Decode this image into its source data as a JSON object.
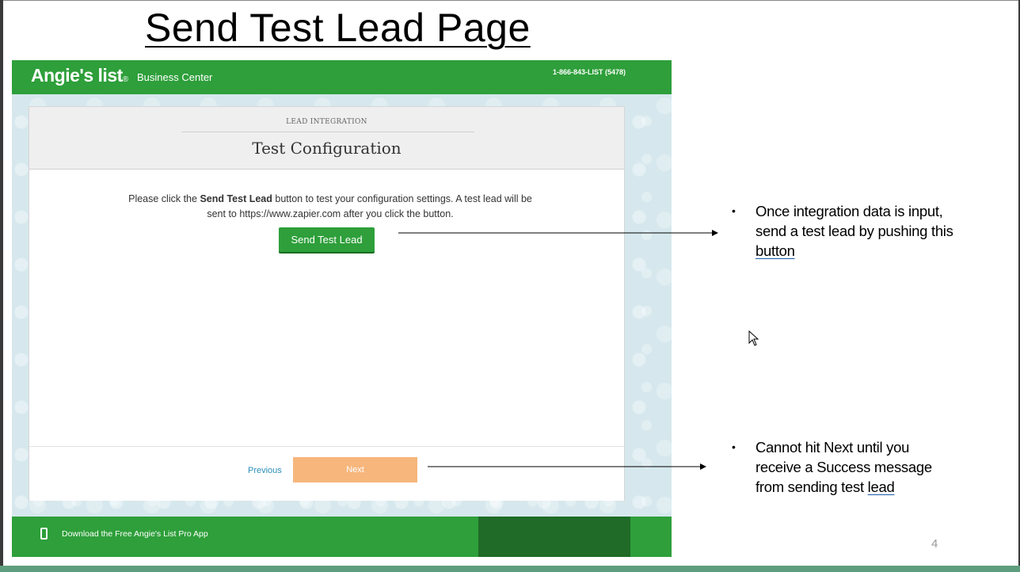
{
  "slide": {
    "title": "Send Test Lead Page",
    "page_number": "4"
  },
  "app": {
    "logo_text": "Angie's list",
    "logo_mark": "®",
    "logo_subtitle": "Business Center",
    "phone": "1-866-843-LIST (5478)",
    "section_label": "LEAD INTEGRATION",
    "card_title": "Test Configuration",
    "instructions_pre": "Please click the ",
    "instructions_bold": "Send Test Lead",
    "instructions_post": " button to test your configuration settings. A test lead will be sent to https://www.zapier.com after you click the button.",
    "send_button_label": "Send Test Lead",
    "previous_label": "Previous",
    "next_label": "Next",
    "footer_text": "Download the Free Angie's List Pro App",
    "colors": {
      "brand_green": "#2e9f3a",
      "next_disabled": "#f6b67c",
      "link_blue": "#2b8fb8"
    }
  },
  "annotations": [
    {
      "text": "Once integration data is input, send a test lead by pushing this ",
      "underlined": "button"
    },
    {
      "text": "Cannot hit Next until you receive a Success message from sending test ",
      "underlined": "lead"
    }
  ],
  "icons": {
    "phone": "mobile-phone-icon",
    "cursor": "mouse-pointer-icon",
    "bullet": "bullet-dot"
  }
}
